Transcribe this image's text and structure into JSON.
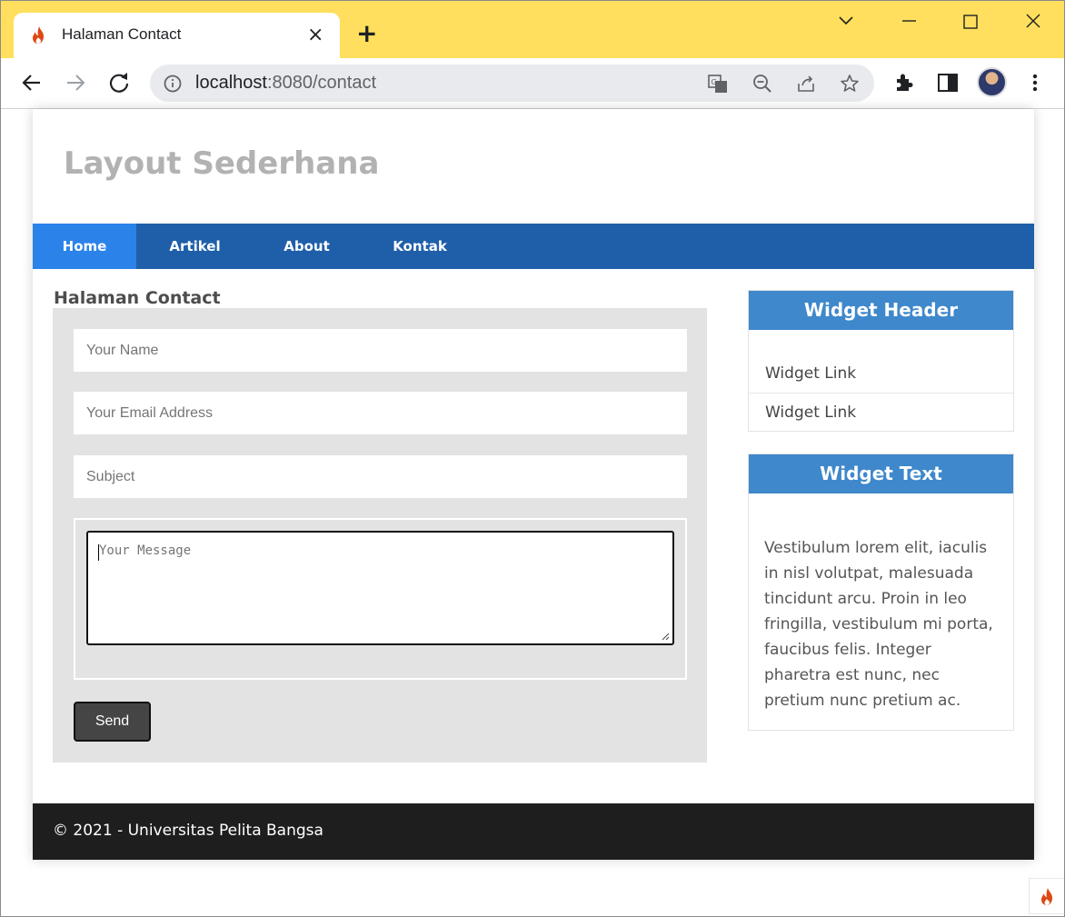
{
  "browser": {
    "tab_title": "Halaman Contact",
    "url_host": "localhost",
    "url_path": ":8080/contact",
    "close_tab_glyph": "×",
    "new_tab_glyph": "+"
  },
  "site": {
    "title": "Layout Sederhana",
    "nav": [
      {
        "label": "Home",
        "active": true
      },
      {
        "label": "Artikel",
        "active": false
      },
      {
        "label": "About",
        "active": false
      },
      {
        "label": "Kontak",
        "active": false
      }
    ]
  },
  "main": {
    "heading": "Halaman Contact",
    "form": {
      "name_placeholder": "Your Name",
      "email_placeholder": "Your Email Address",
      "subject_placeholder": "Subject",
      "message_placeholder": "Your Message",
      "send_label": "Send"
    }
  },
  "sidebar": {
    "widget1": {
      "header": "Widget Header",
      "links": [
        "Widget Link",
        "Widget Link"
      ]
    },
    "widget2": {
      "header": "Widget Text",
      "text": "Vestibulum lorem elit, iaculis in nisl volutpat, malesuada tincidunt arcu. Proin in leo fringilla, vestibulum mi porta, faucibus felis. Integer pharetra est nunc, nec pretium nunc pretium ac."
    }
  },
  "footer": {
    "text": "© 2021 - Universitas Pelita Bangsa"
  },
  "colors": {
    "tabbar_bg": "#ffdf5d",
    "navbar": "#1f5faa",
    "nav_active": "#2b83ea",
    "widget_header": "#3e88cb",
    "footer": "#1e1e1e"
  },
  "icons": [
    "flame-icon",
    "back-arrow-icon",
    "forward-arrow-icon",
    "reload-icon",
    "info-icon",
    "translate-icon",
    "zoom-out-icon",
    "share-icon",
    "star-icon",
    "extensions-icon",
    "side-panel-icon",
    "menu-icon"
  ]
}
